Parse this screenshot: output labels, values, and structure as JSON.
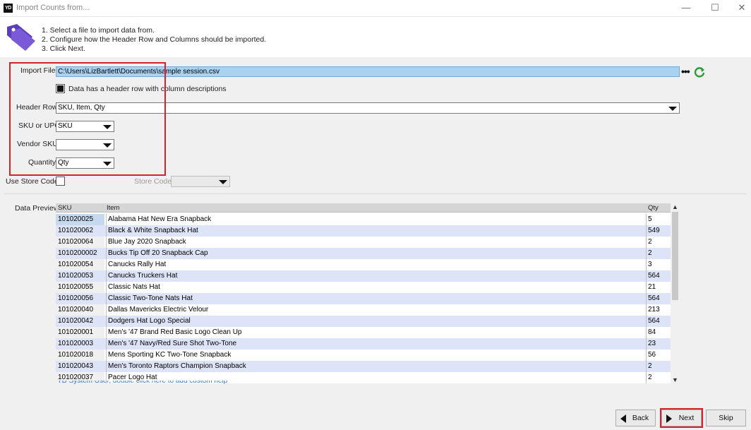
{
  "window": {
    "app_icon_text": "YD",
    "title": "Import Counts from...",
    "min": "—",
    "max": "☐",
    "close": "✕"
  },
  "instructions": [
    "1. Select a file to import data from.",
    "2. Configure how the Header Row and Columns should be imported.",
    "3. Click Next."
  ],
  "form": {
    "import_file_label": "Import File",
    "import_file_value": "C:\\Users\\LizBartlett\\Documents\\sample session.csv",
    "browse_label": "•••",
    "header_checkbox_label": "Data has a header row with column descriptions",
    "header_checkbox_checked": true,
    "header_row_label": "Header Row",
    "header_row_value": "SKU, Item, Qty",
    "sku_upc_label": "SKU or UPC",
    "sku_upc_value": "SKU",
    "vendor_sku_label": "Vendor SKU",
    "vendor_sku_value": "",
    "quantity_label": "Quantity",
    "quantity_value": "Qty",
    "use_store_code_label": "Use Store Code",
    "use_store_code_checked": false,
    "store_code_label": "Store Code",
    "store_code_value": ""
  },
  "preview": {
    "label": "Data Preview",
    "columns": [
      "SKU",
      "Item",
      "Qty"
    ],
    "rows": [
      [
        "101020025",
        "Alabama Hat New Era Snapback",
        "5"
      ],
      [
        "101020062",
        "Black & White Snapback Hat",
        "549"
      ],
      [
        "101020064",
        "Blue Jay 2020 Snapback",
        "2"
      ],
      [
        "1010200002",
        "Bucks Tip Off 20 Snapback Cap",
        "2"
      ],
      [
        "101020054",
        "Canucks Rally Hat",
        "3"
      ],
      [
        "101020053",
        "Canucks Truckers Hat",
        "564"
      ],
      [
        "101020055",
        "Classic Nats Hat",
        "21"
      ],
      [
        "101020056",
        "Classic Two-Tone Nats Hat",
        "564"
      ],
      [
        "101020040",
        "Dallas Mavericks Electric Velour",
        "213"
      ],
      [
        "101020042",
        "Dodgers Hat Logo Special",
        "564"
      ],
      [
        "101020001",
        "Men's '47 Brand Red Basic Logo Clean Up",
        "84"
      ],
      [
        "101020003",
        "Men's '47 Navy/Red Sure Shot Two-Tone",
        "23"
      ],
      [
        "101020018",
        "Mens Sporting KC Two-Tone Snapback",
        "56"
      ],
      [
        "101020043",
        "Men's Toronto Raptors Champion Snapback",
        "2"
      ],
      [
        "101020037",
        "Pacer Logo Hat",
        "2"
      ]
    ],
    "help_text": "YD System User, double click here to add custom help"
  },
  "buttons": {
    "back": "Back",
    "next": "Next",
    "skip": "Skip"
  },
  "colors": {
    "highlight_red": "#d3242b",
    "file_input_bg": "#a8d2f2",
    "tag_icon": "#5b3fb8",
    "refresh_icon": "#2e9a3a"
  }
}
